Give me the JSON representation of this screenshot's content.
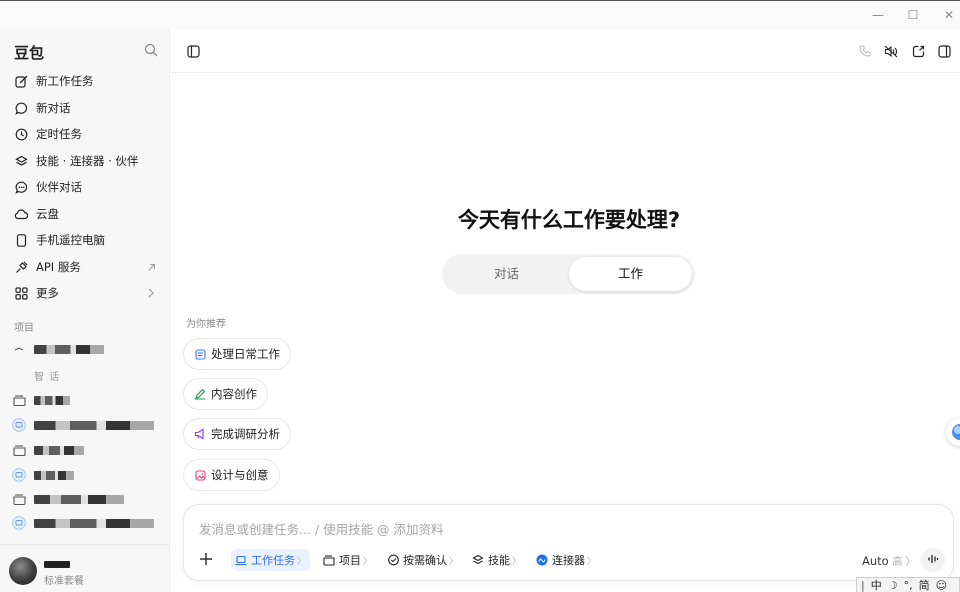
{
  "window": {
    "minimize": "—",
    "maximize": "☐",
    "close": "✕"
  },
  "sidebar": {
    "brand": "豆包",
    "items": [
      {
        "label": "新工作任务",
        "icon": "edit-icon"
      },
      {
        "label": "新对话",
        "icon": "chat-bubble-icon"
      },
      {
        "label": "定时任务",
        "icon": "clock-icon"
      },
      {
        "label": "技能 · 连接器 · 伙伴",
        "icon": "layers-icon"
      },
      {
        "label": "伙伴对话",
        "icon": "chat-dots-icon"
      },
      {
        "label": "云盘",
        "icon": "cloud-icon"
      },
      {
        "label": "手机遥控电脑",
        "icon": "phone-icon"
      },
      {
        "label": "API 服务",
        "icon": "api-plug-icon"
      },
      {
        "label": "更多",
        "icon": "grid-icon"
      }
    ],
    "section_label": "项目",
    "sub_project": "智 话",
    "user": {
      "plan": "标准套餐"
    }
  },
  "main": {
    "headline": "今天有什么工作要处理?",
    "toggle": {
      "chat": "对话",
      "work": "工作"
    },
    "recommend_label": "为你推荐",
    "chips": [
      {
        "label": "处理日常工作",
        "icon": "document-icon",
        "color": "#3b74f0"
      },
      {
        "label": "内容创作",
        "icon": "pen-icon",
        "color": "#1a9a4a"
      },
      {
        "label": "完成调研分析",
        "icon": "megaphone-icon",
        "color": "#8a3bd9"
      },
      {
        "label": "设计与创意",
        "icon": "image-icon",
        "color": "#e0427d"
      }
    ],
    "composer": {
      "placeholder": "发消息或创建任务... / 使用技能 @ 添加资料",
      "tools": [
        {
          "label": "工作任务",
          "icon": "laptop-icon"
        },
        {
          "label": "项目",
          "icon": "folder-icon"
        },
        {
          "label": "按需确认",
          "icon": "shield-check-icon"
        },
        {
          "label": "技能",
          "icon": "layers-icon"
        },
        {
          "label": "连接器",
          "icon": "connector-icon"
        }
      ],
      "model": "Auto",
      "model_level": "高"
    }
  },
  "ime": {
    "mode": "中",
    "moon": "☽",
    "punct": "°,",
    "simp": "简",
    "emoji": "☺"
  }
}
